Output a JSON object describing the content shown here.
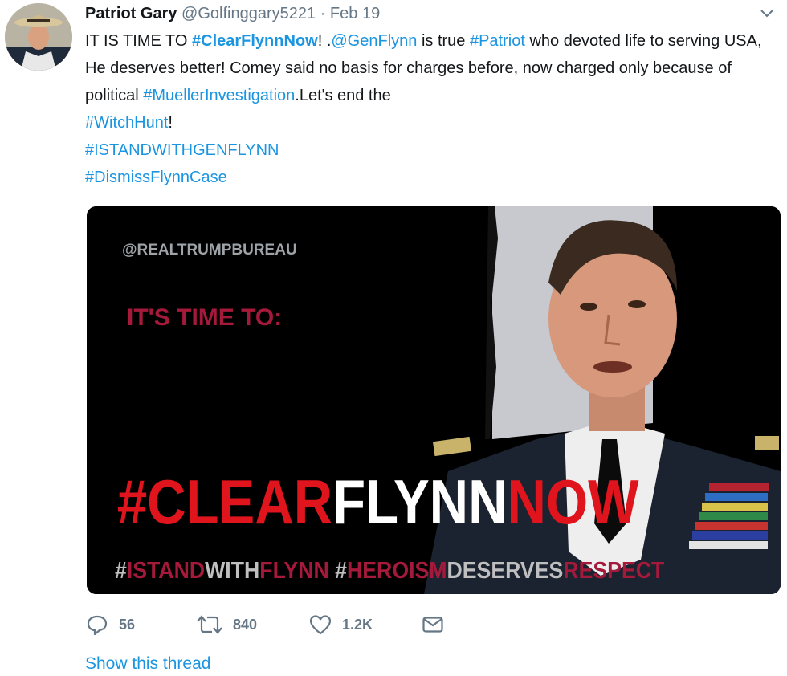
{
  "tweet": {
    "display_name": "Patriot Gary",
    "handle": "@Golfinggary5221",
    "separator": "·",
    "date": "Feb 19",
    "text": {
      "p1": "IT IS TIME TO ",
      "tag1": "#ClearFlynnNow",
      "p2": "! .",
      "mention": "@GenFlynn",
      "p3": " is true ",
      "tag2": "#Patriot",
      "p4": " who devoted life to serving USA, He deserves better! Comey said no basis for charges before, now charged only because of political ",
      "tag3": "#MuellerInvestigation",
      "p5": ".Let's end the ",
      "tag4": "#WitchHunt",
      "p6": "!",
      "tag5": "#ISTANDWITHGENFLYNN",
      "tag6": "#DismissFlynnCase"
    },
    "image": {
      "watermark": "@REALTRUMPBUREAU",
      "headline": "IT'S TIME TO:",
      "big_red1": "#CLEAR",
      "big_white": "FLYNN",
      "big_red2": "NOW",
      "b_hash1": "#",
      "b_istand": "ISTAND",
      "b_with": "WITH",
      "b_flynn": "FLYNN",
      "b_hash2": " #",
      "b_heroism": "HEROISM",
      "b_deserves": "DESERVES",
      "b_respect": "RESPECT"
    },
    "actions": {
      "replies": "56",
      "retweets": "840",
      "likes": "1.2K"
    },
    "show_thread": "Show this thread"
  },
  "colors": {
    "link": "#1b95e0",
    "muted": "#657786",
    "poster_red": "#e0141c",
    "poster_maroon": "#a5193a"
  },
  "icons": [
    "chevron-down-icon",
    "reply-icon",
    "retweet-icon",
    "heart-icon",
    "dm-envelope-icon"
  ]
}
